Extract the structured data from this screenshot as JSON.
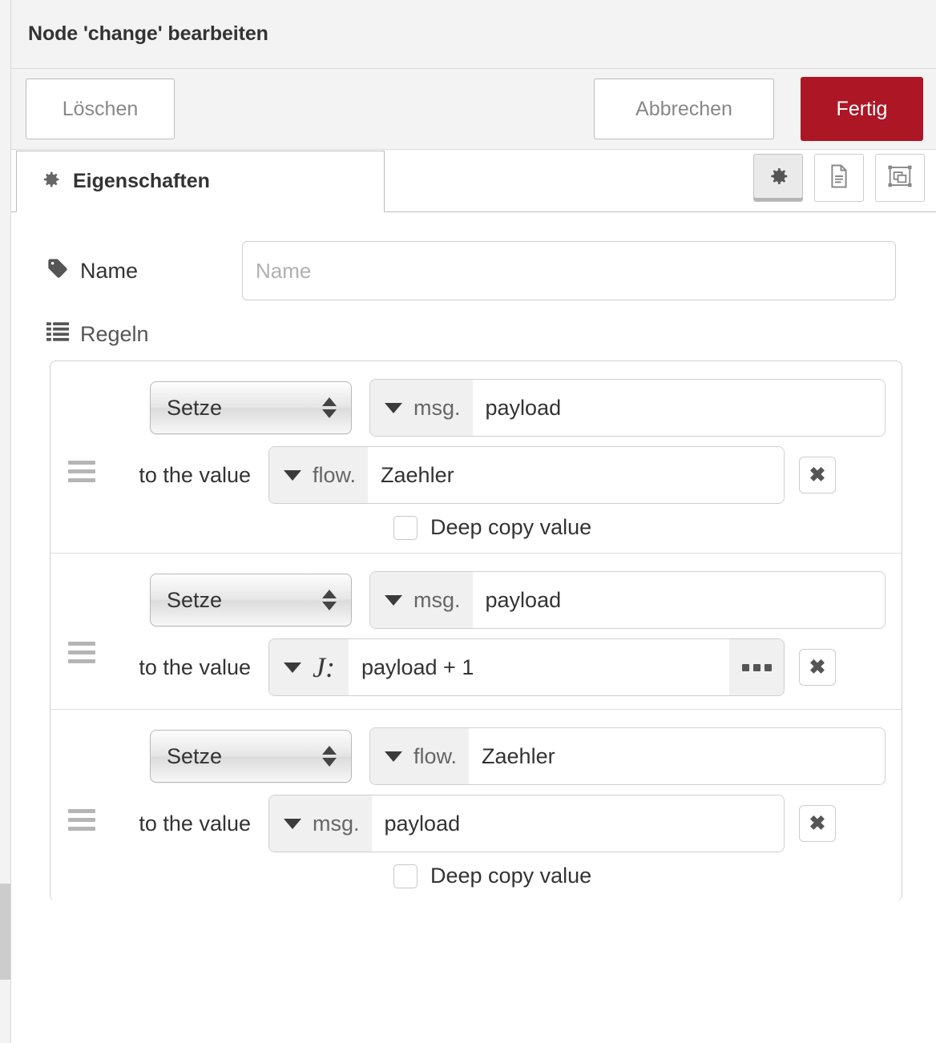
{
  "dialog": {
    "title": "Node 'change' bearbeiten",
    "buttons": {
      "delete_label": "Löschen",
      "cancel_label": "Abbrechen",
      "done_label": "Fertig",
      "primary_color": "#ad1625"
    }
  },
  "tabs": [
    {
      "label": "Eigenschaften",
      "icon": "gear-icon",
      "active": true
    }
  ],
  "tab_tools": [
    {
      "icon": "gear-icon",
      "name": "properties-tool",
      "active": true
    },
    {
      "icon": "description-icon",
      "name": "description-tool",
      "active": false
    },
    {
      "icon": "appearance-icon",
      "name": "appearance-tool",
      "active": false
    }
  ],
  "form": {
    "name": {
      "icon": "tag-icon",
      "label": "Name",
      "value": "",
      "placeholder": "Name"
    },
    "rules_section": {
      "icon": "list-icon",
      "label": "Regeln"
    }
  },
  "rules": [
    {
      "operation": "Setze",
      "target": {
        "prefix": "msg.",
        "value": "payload"
      },
      "to_label": "to the value",
      "source": {
        "type": "context",
        "prefix": "flow.",
        "value": "Zaehler"
      },
      "deep_copy": {
        "label": "Deep copy value",
        "checked": false
      },
      "delete_label": "✖"
    },
    {
      "operation": "Setze",
      "target": {
        "prefix": "msg.",
        "value": "payload"
      },
      "to_label": "to the value",
      "source": {
        "type": "jsonata",
        "prefix": "J:",
        "value": "payload + 1",
        "expand_label": "•••"
      },
      "deep_copy": null,
      "delete_label": "✖"
    },
    {
      "operation": "Setze",
      "target": {
        "prefix": "flow.",
        "value": "Zaehler"
      },
      "to_label": "to the value",
      "source": {
        "type": "msg",
        "prefix": "msg.",
        "value": "payload"
      },
      "deep_copy": {
        "label": "Deep copy value",
        "checked": false
      },
      "delete_label": "✖"
    }
  ]
}
